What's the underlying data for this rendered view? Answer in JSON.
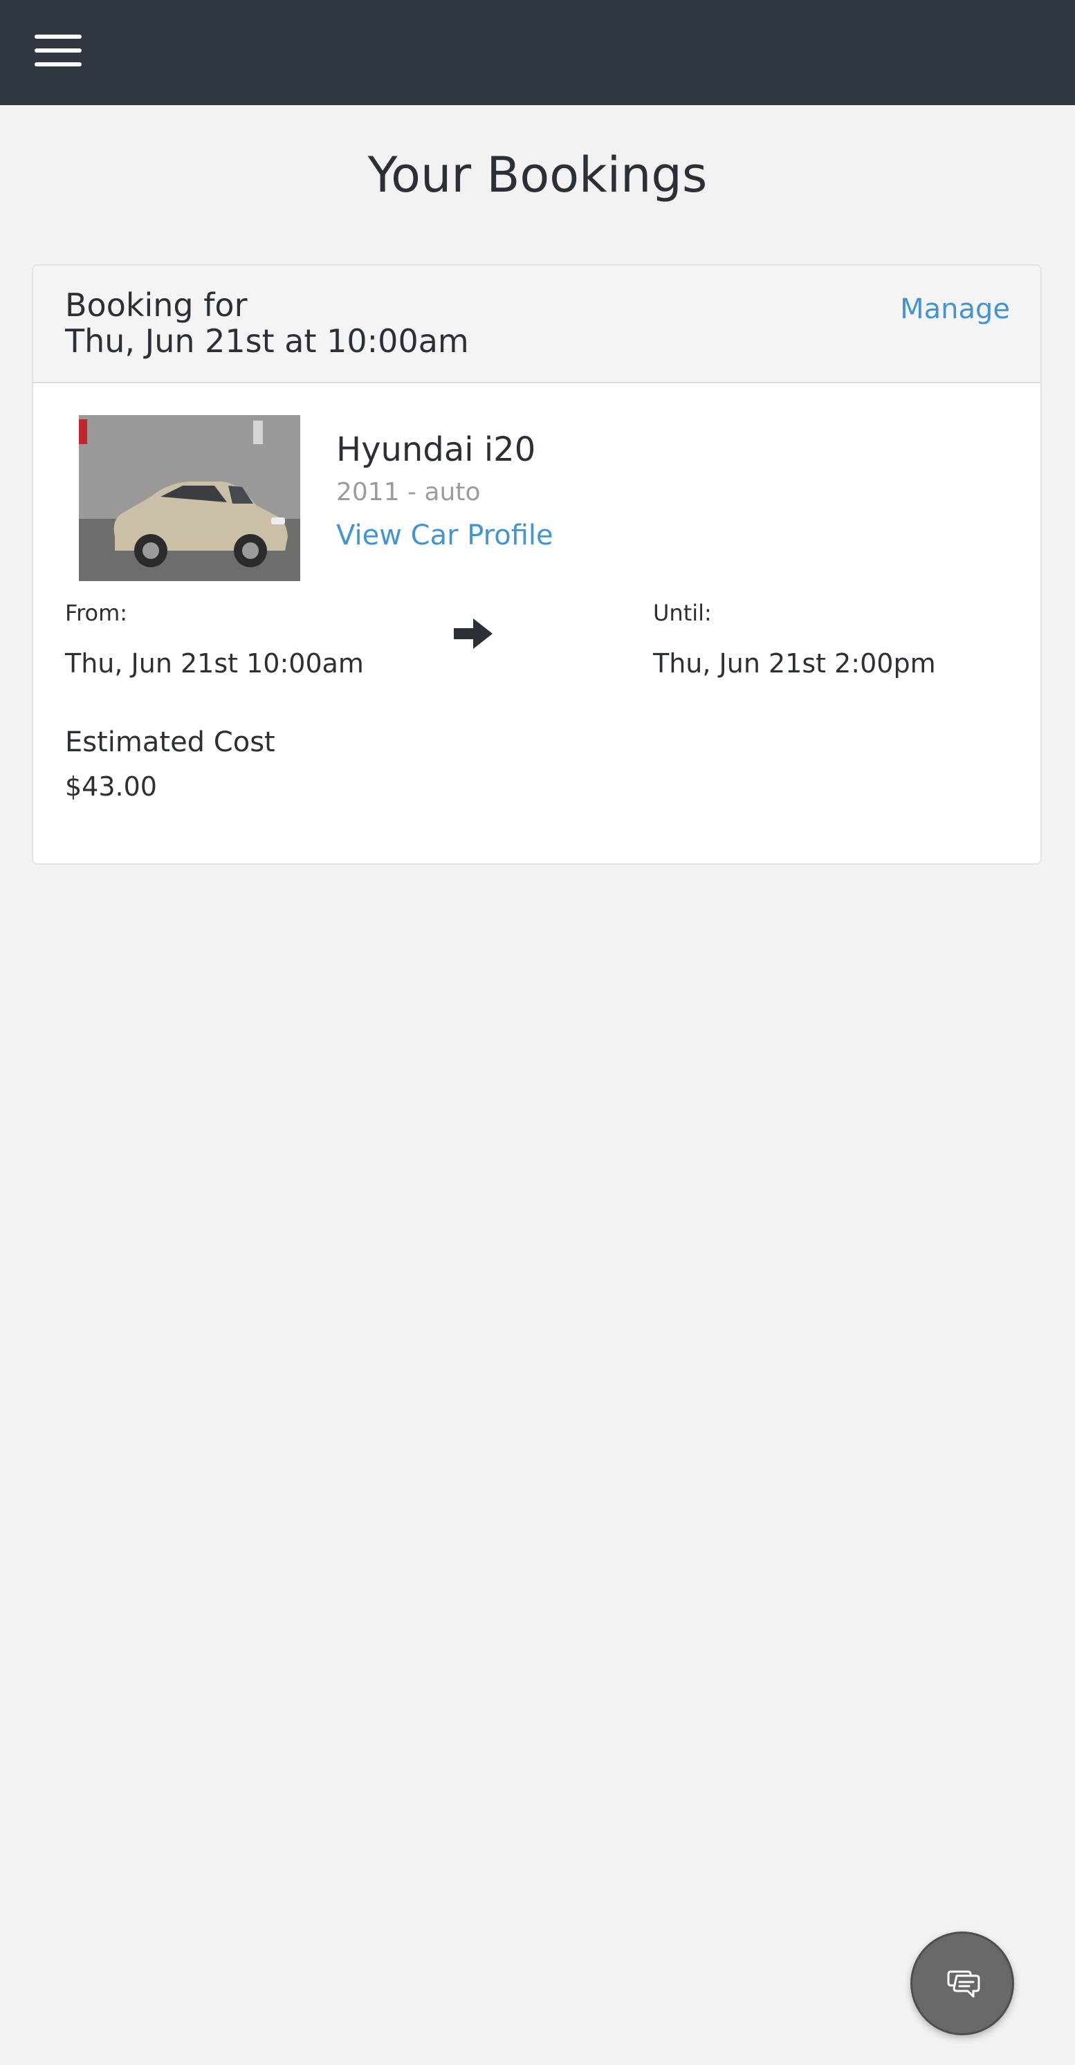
{
  "header": {
    "menu_icon": "hamburger-menu-icon",
    "background": "#323841"
  },
  "page": {
    "title": "Your Bookings"
  },
  "booking": {
    "heading": "Booking for",
    "date": "Thu, Jun 21st at 10:00am",
    "manage_label": "Manage",
    "car": {
      "name": "Hyundai i20",
      "subtitle": "2011 - auto",
      "profile_link": "View Car Profile",
      "photo_alt": "Hyundai i20 photo"
    },
    "from_label": "From:",
    "from_value": "Thu, Jun 21st 10:00am",
    "until_label": "Until:",
    "until_value": "Thu, Jun 21st 2:00pm",
    "arrow_icon": "right-arrow-icon",
    "cost_label": "Estimated Cost",
    "cost_value": "$43.00"
  },
  "chat": {
    "icon": "chat-bubbles-icon"
  },
  "colors": {
    "accent": "#4295ce",
    "page_background": "#f2f2f2",
    "text": "#2b2f36",
    "muted": "#9c9c9c"
  }
}
